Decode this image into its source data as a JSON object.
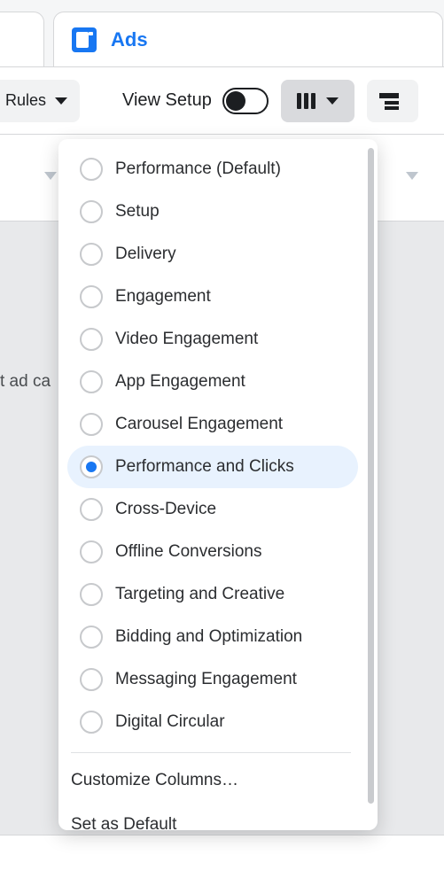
{
  "tab": {
    "label": "Ads"
  },
  "toolbar": {
    "rules_label": "Rules",
    "view_setup_label": "View Setup"
  },
  "body": {
    "snippet": "t ad ca"
  },
  "menu": {
    "options": [
      {
        "label": "Performance (Default)",
        "selected": false
      },
      {
        "label": "Setup",
        "selected": false
      },
      {
        "label": "Delivery",
        "selected": false
      },
      {
        "label": "Engagement",
        "selected": false
      },
      {
        "label": "Video Engagement",
        "selected": false
      },
      {
        "label": "App Engagement",
        "selected": false
      },
      {
        "label": "Carousel Engagement",
        "selected": false
      },
      {
        "label": "Performance and Clicks",
        "selected": true
      },
      {
        "label": "Cross-Device",
        "selected": false
      },
      {
        "label": "Offline Conversions",
        "selected": false
      },
      {
        "label": "Targeting and Creative",
        "selected": false
      },
      {
        "label": "Bidding and Optimization",
        "selected": false
      },
      {
        "label": "Messaging Engagement",
        "selected": false
      },
      {
        "label": "Digital Circular",
        "selected": false
      }
    ],
    "customize_label": "Customize Columns…",
    "default_label": "Set as Default"
  }
}
